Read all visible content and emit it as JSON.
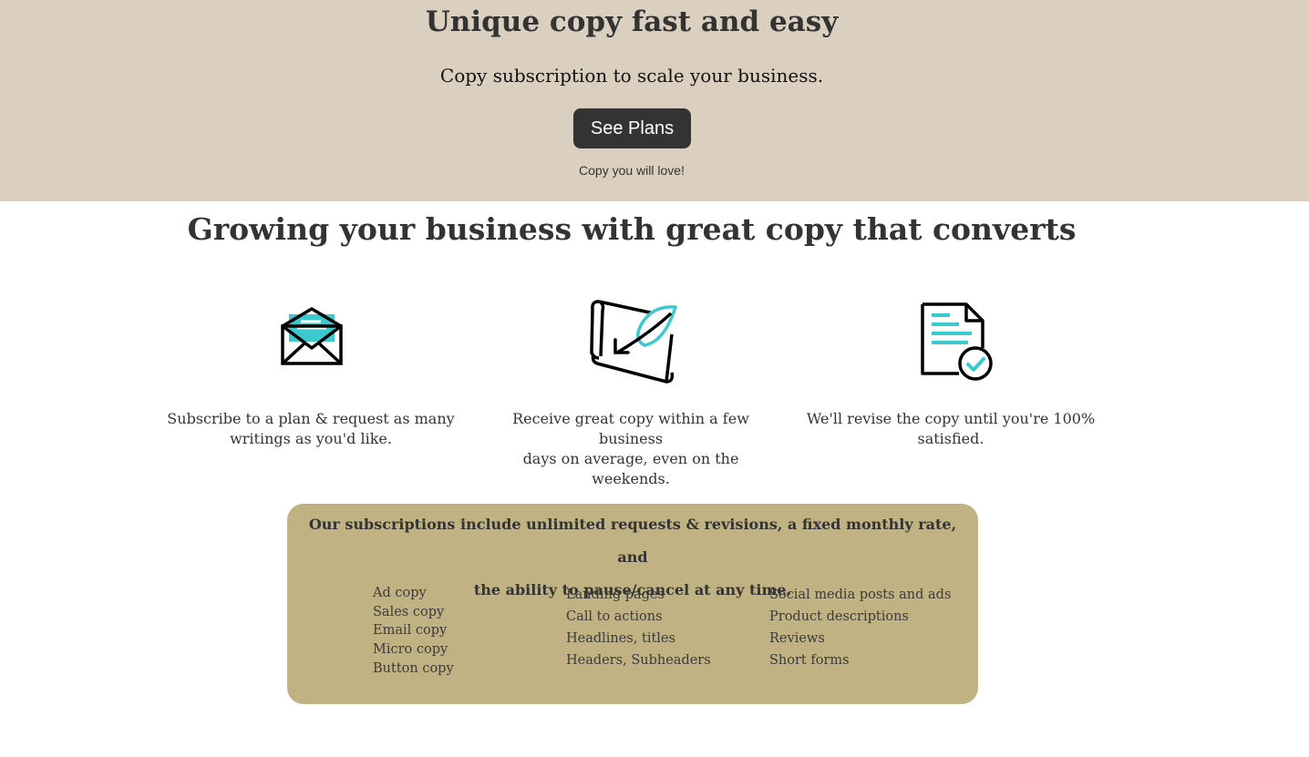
{
  "hero": {
    "title": "Unique copy fast and easy",
    "subtitle": "Copy subscription to scale your business.",
    "button_label": "See Plans",
    "caption": "Copy you will love!",
    "background_color": "#dbcfc0",
    "button_color": "#333333"
  },
  "features": {
    "title": "Growing your business with great copy that converts",
    "items": [
      {
        "icon": "envelope-letter-icon",
        "line1": "Subscribe to a plan & request as many",
        "line2": "writings as you'd like."
      },
      {
        "icon": "scroll-feather-icon",
        "line1": "Receive great copy within a few business",
        "line2": "days on average, even on the weekends."
      },
      {
        "icon": "document-check-icon",
        "line1": "We'll revise the copy until you're 100%",
        "line2": "satisfied."
      }
    ],
    "accent_color": "#3cc8cf"
  },
  "subscriptions": {
    "heading_line1": "Our subscriptions include unlimited requests & revisions, a fixed monthly rate, and",
    "heading_line2": "the ability to pause/cancel at any time.",
    "background_color": "#c0b282",
    "columns": [
      [
        "Ad copy",
        "Sales copy",
        "Email copy",
        "Micro copy",
        "Button copy"
      ],
      [
        "Landing pages",
        "Call to actions",
        "Headlines, titles",
        "Headers, Subheaders"
      ],
      [
        "Social media posts and ads",
        "Product descriptions",
        "Reviews",
        "Short forms"
      ]
    ]
  }
}
